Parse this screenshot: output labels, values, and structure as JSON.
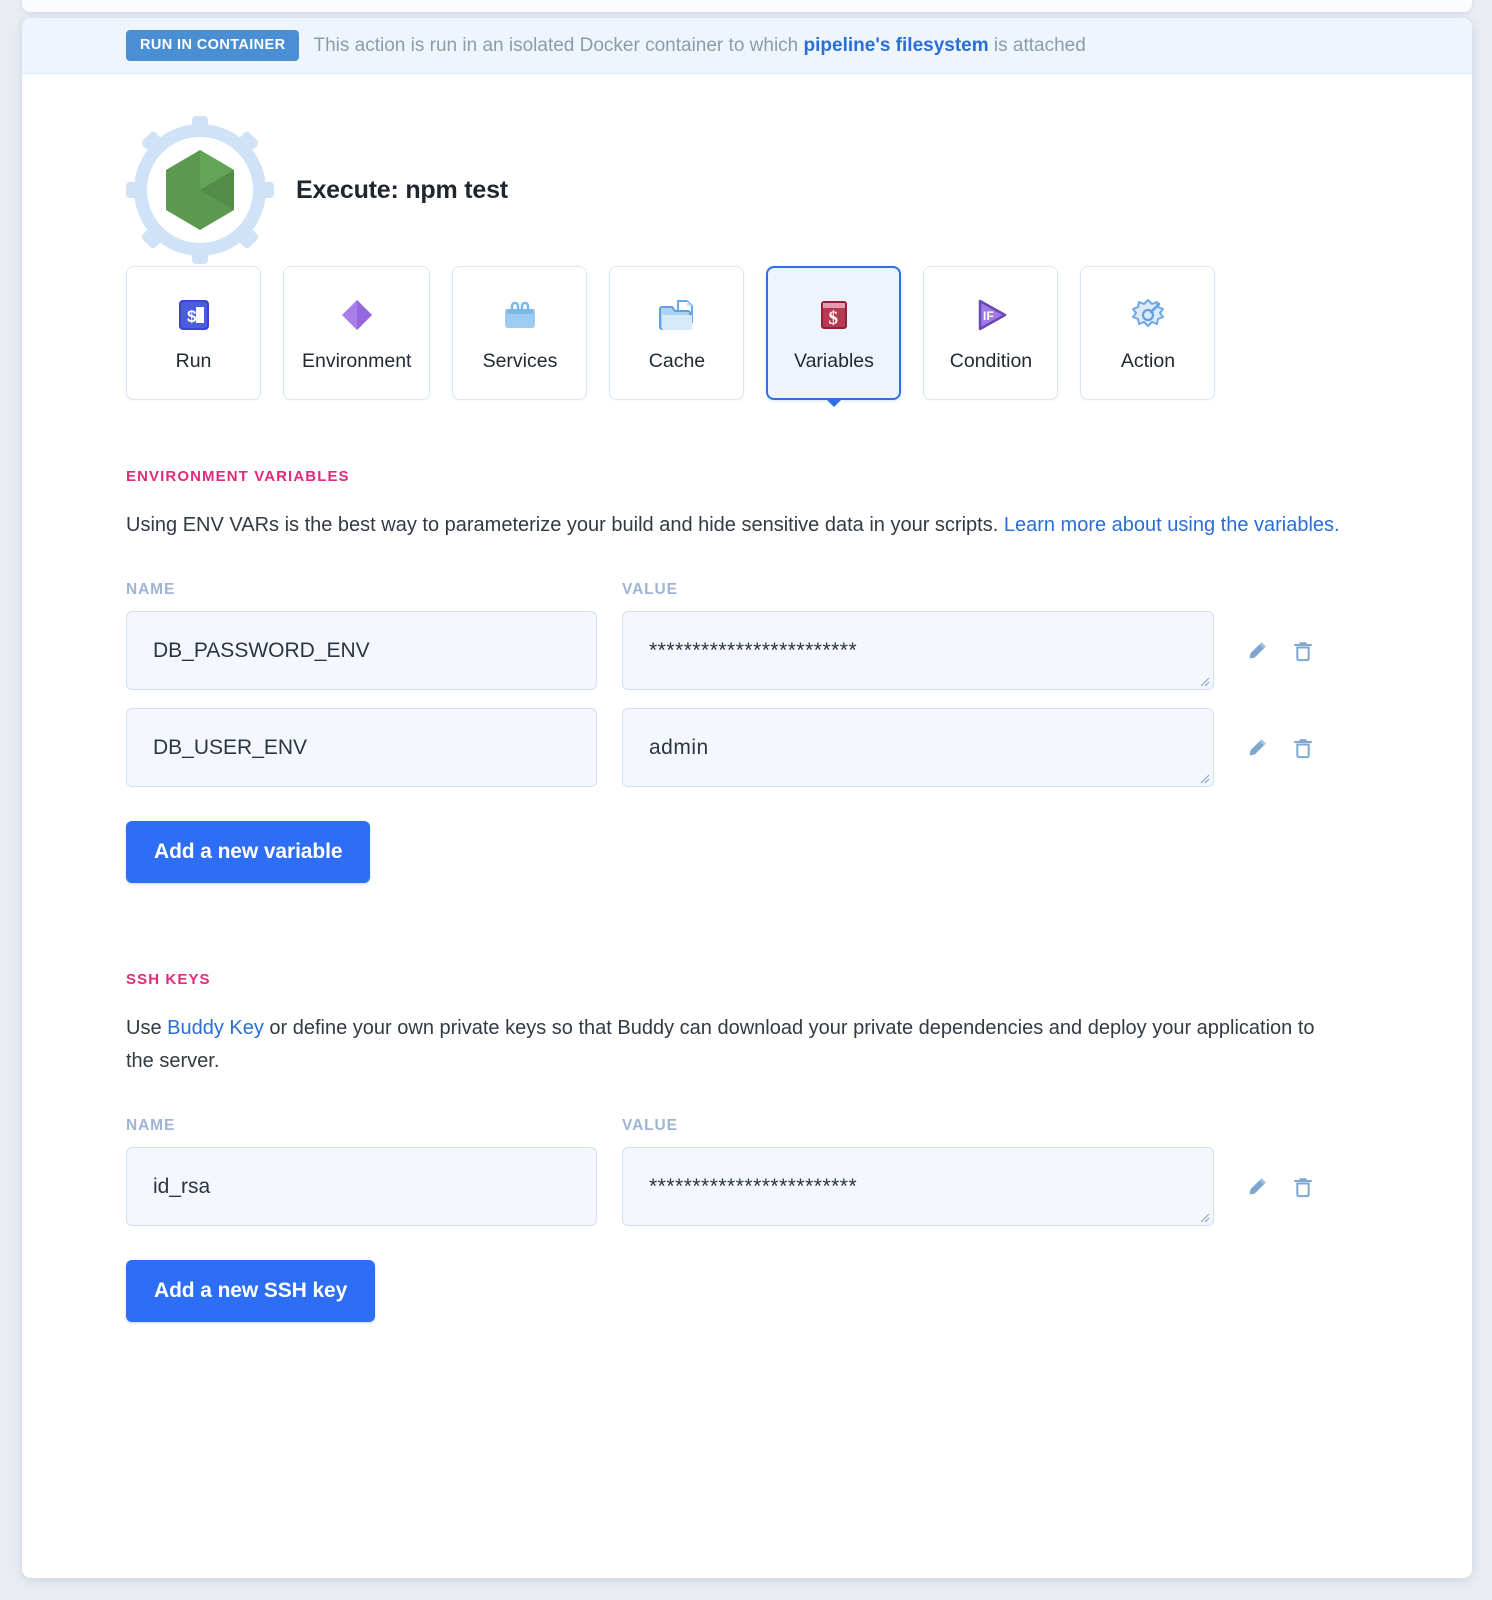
{
  "banner": {
    "badge": "RUN IN CONTAINER",
    "text_before": "This action is run in an isolated Docker container to which ",
    "link": "pipeline's filesystem",
    "text_after": " is attached"
  },
  "header": {
    "title": "Execute: npm test",
    "icon": "nodejs-gear-icon"
  },
  "tabs": [
    {
      "label": "Run",
      "icon": "terminal-prompt-icon",
      "active": false
    },
    {
      "label": "Environment",
      "icon": "purple-diamond-icon",
      "active": false
    },
    {
      "label": "Services",
      "icon": "services-bags-icon",
      "active": false
    },
    {
      "label": "Cache",
      "icon": "folder-document-icon",
      "active": false
    },
    {
      "label": "Variables",
      "icon": "dollar-card-icon",
      "active": true
    },
    {
      "label": "Condition",
      "icon": "if-play-icon",
      "active": false
    },
    {
      "label": "Action",
      "icon": "cloud-burst-icon",
      "active": false
    }
  ],
  "environment_variables": {
    "heading": "ENVIRONMENT VARIABLES",
    "description_before": "Using ENV VARs is the best way to parameterize your build and hide sensitive data in your scripts. ",
    "description_link": "Learn more about using the variables.",
    "col_name": "NAME",
    "col_value": "VALUE",
    "rows": [
      {
        "name": "DB_PASSWORD_ENV",
        "value": "************************"
      },
      {
        "name": "DB_USER_ENV",
        "value": "admin"
      }
    ],
    "add_button": "Add a new variable"
  },
  "ssh_keys": {
    "heading": "SSH KEYS",
    "description_before": "Use ",
    "description_link": "Buddy Key",
    "description_after": " or define your own private keys so that Buddy can download your private dependencies and deploy your application to the server.",
    "col_name": "NAME",
    "col_value": "VALUE",
    "rows": [
      {
        "name": "id_rsa",
        "value": "************************"
      }
    ],
    "add_button": "Add a new SSH key"
  },
  "row_actions": {
    "edit": "pencil-icon",
    "delete": "trash-icon"
  },
  "colors": {
    "accent_blue": "#2d6ef5",
    "banner_badge": "#4a8fd4",
    "section_heading_pink": "#e02b7f",
    "link_blue": "#2a6ed6",
    "field_bg": "#f4f8fe",
    "field_border": "#cfe0f5",
    "label_gray": "#9fb4d4"
  }
}
